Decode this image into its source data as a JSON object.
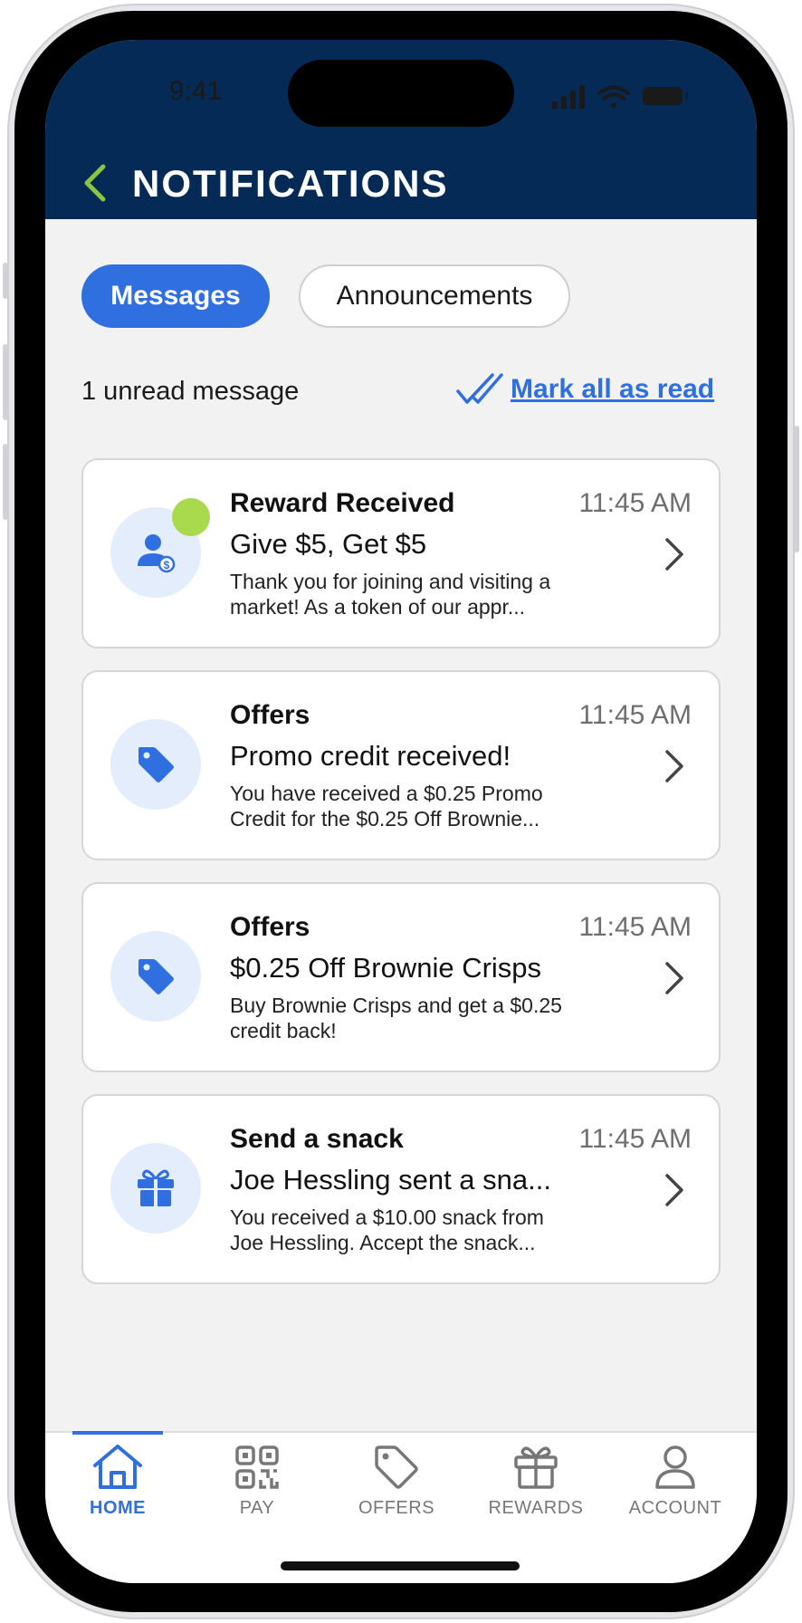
{
  "status_bar": {
    "time": "9:41"
  },
  "header": {
    "title": "NOTIFICATIONS"
  },
  "tabs": [
    {
      "label": "Messages",
      "active": true
    },
    {
      "label": "Announcements",
      "active": false
    }
  ],
  "summary": {
    "unread_text": "1 unread message",
    "mark_all_label": "Mark all as read"
  },
  "notifications": [
    {
      "category": "Reward Received",
      "time": "11:45 AM",
      "title": "Give $5, Get $5",
      "body": "Thank you for joining and visiting a market! As a token of our appr...",
      "icon": "user-dollar-icon",
      "unread": true
    },
    {
      "category": "Offers",
      "time": "11:45 AM",
      "title": "Promo credit received!",
      "body": "You have received a $0.25 Promo Credit for the $0.25 Off Brownie...",
      "icon": "tag-icon",
      "unread": false
    },
    {
      "category": "Offers",
      "time": "11:45 AM",
      "title": "$0.25 Off Brownie Crisps",
      "body": "Buy Brownie Crisps and get a $0.25 credit back!",
      "icon": "tag-icon",
      "unread": false
    },
    {
      "category": "Send a snack",
      "time": "11:45 AM",
      "title": "Joe Hessling sent a sna...",
      "body": "You received a $10.00 snack from Joe Hessling. Accept the snack...",
      "icon": "gift-icon",
      "unread": false
    }
  ],
  "bottom_nav": [
    {
      "label": "HOME",
      "icon": "home-icon",
      "active": true
    },
    {
      "label": "PAY",
      "icon": "qr-code-icon",
      "active": false
    },
    {
      "label": "OFFERS",
      "icon": "tag-icon",
      "active": false
    },
    {
      "label": "REWARDS",
      "icon": "gift-icon",
      "active": false
    },
    {
      "label": "ACCOUNT",
      "icon": "person-icon",
      "active": false
    }
  ],
  "colors": {
    "header_bg": "#052a55",
    "accent": "#2f6fe0",
    "unread_dot": "#a9d94d",
    "back_chevron": "#8cc63f",
    "icon_bg": "#e4edfb"
  }
}
